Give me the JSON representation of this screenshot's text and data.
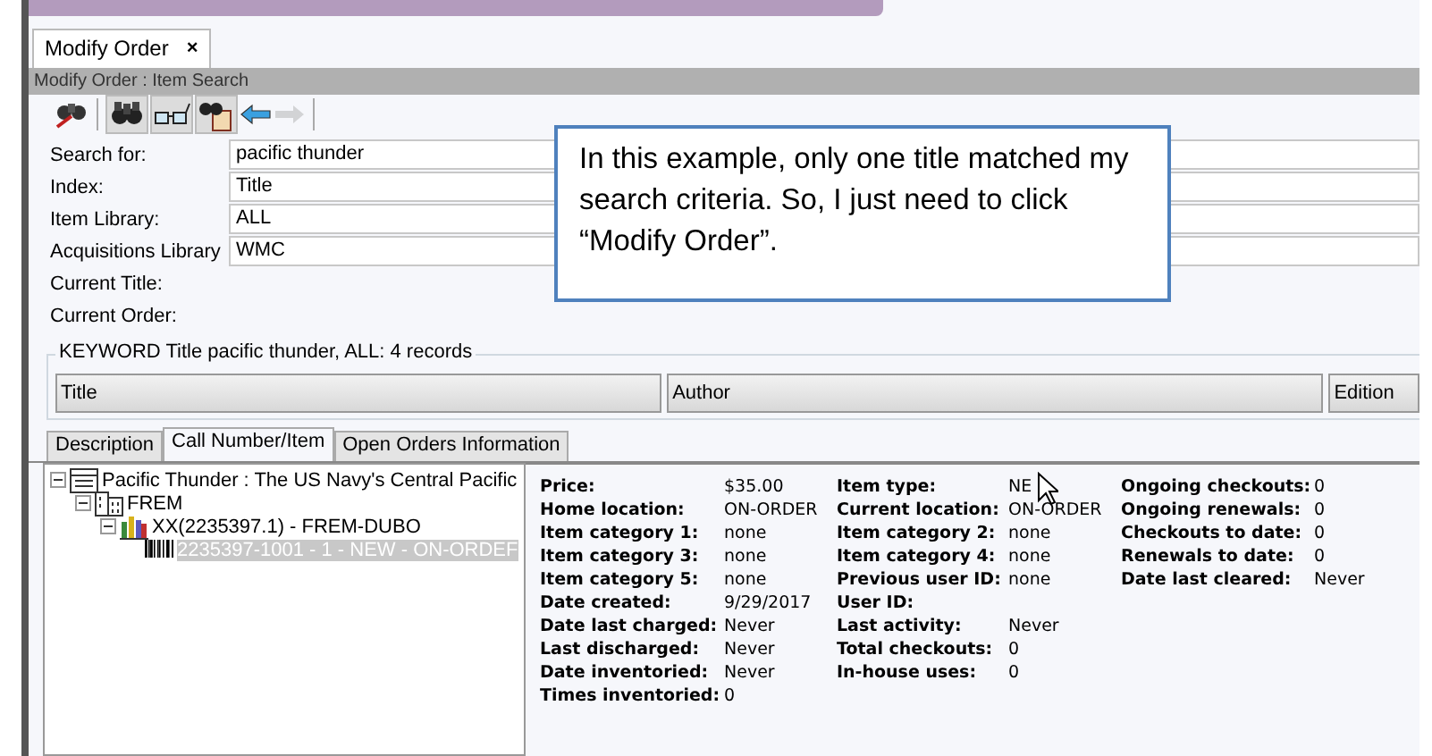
{
  "doc_tab": {
    "label": "Modify Order",
    "close": "×"
  },
  "panel_title": "Modify Order : Item Search",
  "toolbar": [
    {
      "kind": "search-clear",
      "disabled": false
    },
    {
      "kind": "binoculars",
      "disabled": false
    },
    {
      "kind": "glasses",
      "disabled": false
    },
    {
      "kind": "book-search",
      "disabled": false
    },
    {
      "kind": "back",
      "disabled": false
    },
    {
      "kind": "forward",
      "disabled": true
    }
  ],
  "form": [
    {
      "label": "Search for:",
      "value": "pacific thunder"
    },
    {
      "label": "Index:",
      "value": "Title"
    },
    {
      "label": "Item Library:",
      "value": "ALL"
    },
    {
      "label": "Acquisitions Library",
      "value": "WMC"
    },
    {
      "label": "Current Title:"
    },
    {
      "label": "Current Order:"
    }
  ],
  "callout": "In this example, only one title matched my search criteria. So, I just need to click “Modify Order”.",
  "results": {
    "legend": "KEYWORD Title pacific thunder, ALL: 4 records",
    "columns": [
      "Title",
      "Author",
      "Edition"
    ]
  },
  "tabs": [
    {
      "label": "Description",
      "selected": false
    },
    {
      "label": "Call Number/Item",
      "selected": true
    },
    {
      "label": "Open Orders Information",
      "selected": false
    }
  ],
  "tree": [
    {
      "kind": "title",
      "label": "Pacific Thunder : The US Navy's Central Pacific",
      "expanded": true,
      "selected": false,
      "children": [
        {
          "kind": "library",
          "label": "FREM",
          "expanded": true,
          "selected": false,
          "children": [
            {
              "kind": "callnumber",
              "label": "XX(2235397.1) - FREM-DUBO",
              "expanded": true,
              "selected": false,
              "children": [
                {
                  "kind": "item",
                  "label": "2235397-1001 - 1 - NEW - ON-ORDEF",
                  "selected": true
                }
              ]
            }
          ]
        }
      ]
    }
  ],
  "details": [
    [
      {
        "label": "Price:",
        "value": "$35.00"
      },
      {
        "label": "Home location:",
        "value": "ON-ORDER"
      },
      {
        "label": "Item category 1:",
        "value": "none"
      },
      {
        "label": "Item category 3:",
        "value": "none"
      },
      {
        "label": "Item category 5:",
        "value": "none"
      },
      {
        "label": "Date created:",
        "value": "9/29/2017"
      },
      {
        "label": "Date last charged:",
        "value": "Never"
      },
      {
        "label": "Last discharged:",
        "value": "Never"
      },
      {
        "label": "Date inventoried:",
        "value": "Never"
      },
      {
        "label": "Times inventoried:",
        "value": "0"
      }
    ],
    [
      {
        "label": "Item type:",
        "value": "NE"
      },
      {
        "label": "Current location:",
        "value": "ON-ORDER"
      },
      {
        "label": "Item category 2:",
        "value": "none"
      },
      {
        "label": "Item category 4:",
        "value": "none"
      },
      {
        "label": "Previous user ID:",
        "value": "none"
      },
      {
        "label": "User ID:"
      },
      {
        "label": "Last activity:",
        "value": "Never"
      },
      {
        "label": "Total checkouts:",
        "value": "0"
      },
      {
        "label": "In-house uses:",
        "value": "0"
      }
    ],
    [
      {
        "label": "Ongoing checkouts:",
        "value": "0"
      },
      {
        "label": "Ongoing renewals:",
        "value": "0"
      },
      {
        "label": "Checkouts to date:",
        "value": "0"
      },
      {
        "label": "Renewals to date:",
        "value": "0"
      },
      {
        "label": "Date last cleared:",
        "value": "Never"
      }
    ]
  ]
}
